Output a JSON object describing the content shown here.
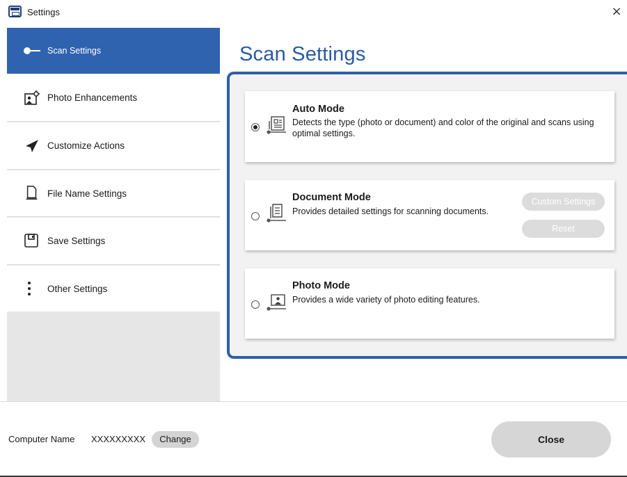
{
  "window": {
    "title": "Settings",
    "close_glyph": "×"
  },
  "sidebar": {
    "items": [
      {
        "label": "Scan Settings",
        "icon": "scan-toggle-icon",
        "active": true
      },
      {
        "label": "Photo Enhancements",
        "icon": "photo-enhance-icon",
        "active": false
      },
      {
        "label": "Customize Actions",
        "icon": "paper-plane-icon",
        "active": false
      },
      {
        "label": "File Name Settings",
        "icon": "file-name-icon",
        "active": false
      },
      {
        "label": "Save Settings",
        "icon": "save-icon",
        "active": false
      },
      {
        "label": "Other Settings",
        "icon": "more-vertical-icon",
        "active": false
      }
    ]
  },
  "main": {
    "title": "Scan Settings",
    "modes": [
      {
        "title": "Auto Mode",
        "description": "Detects the type (photo or document) and color of the original and scans using optimal settings.",
        "selected": true,
        "icon": "auto-mode-icon"
      },
      {
        "title": "Document Mode",
        "description": "Provides detailed settings for scanning documents.",
        "selected": false,
        "icon": "document-mode-icon",
        "buttons": {
          "custom": "Custom Settings",
          "reset": "Reset"
        }
      },
      {
        "title": "Photo Mode",
        "description": "Provides a wide variety of photo editing features.",
        "selected": false,
        "icon": "photo-mode-icon"
      }
    ]
  },
  "footer": {
    "computer_name_label": "Computer Name",
    "computer_name_value": "XXXXXXXXX",
    "change_label": "Change",
    "close_label": "Close"
  },
  "colors": {
    "accent": "#2f63b0",
    "title_blue": "#2a5aa6",
    "panel_border": "#2e5fa8",
    "disabled_button": "#dcdcdc"
  }
}
